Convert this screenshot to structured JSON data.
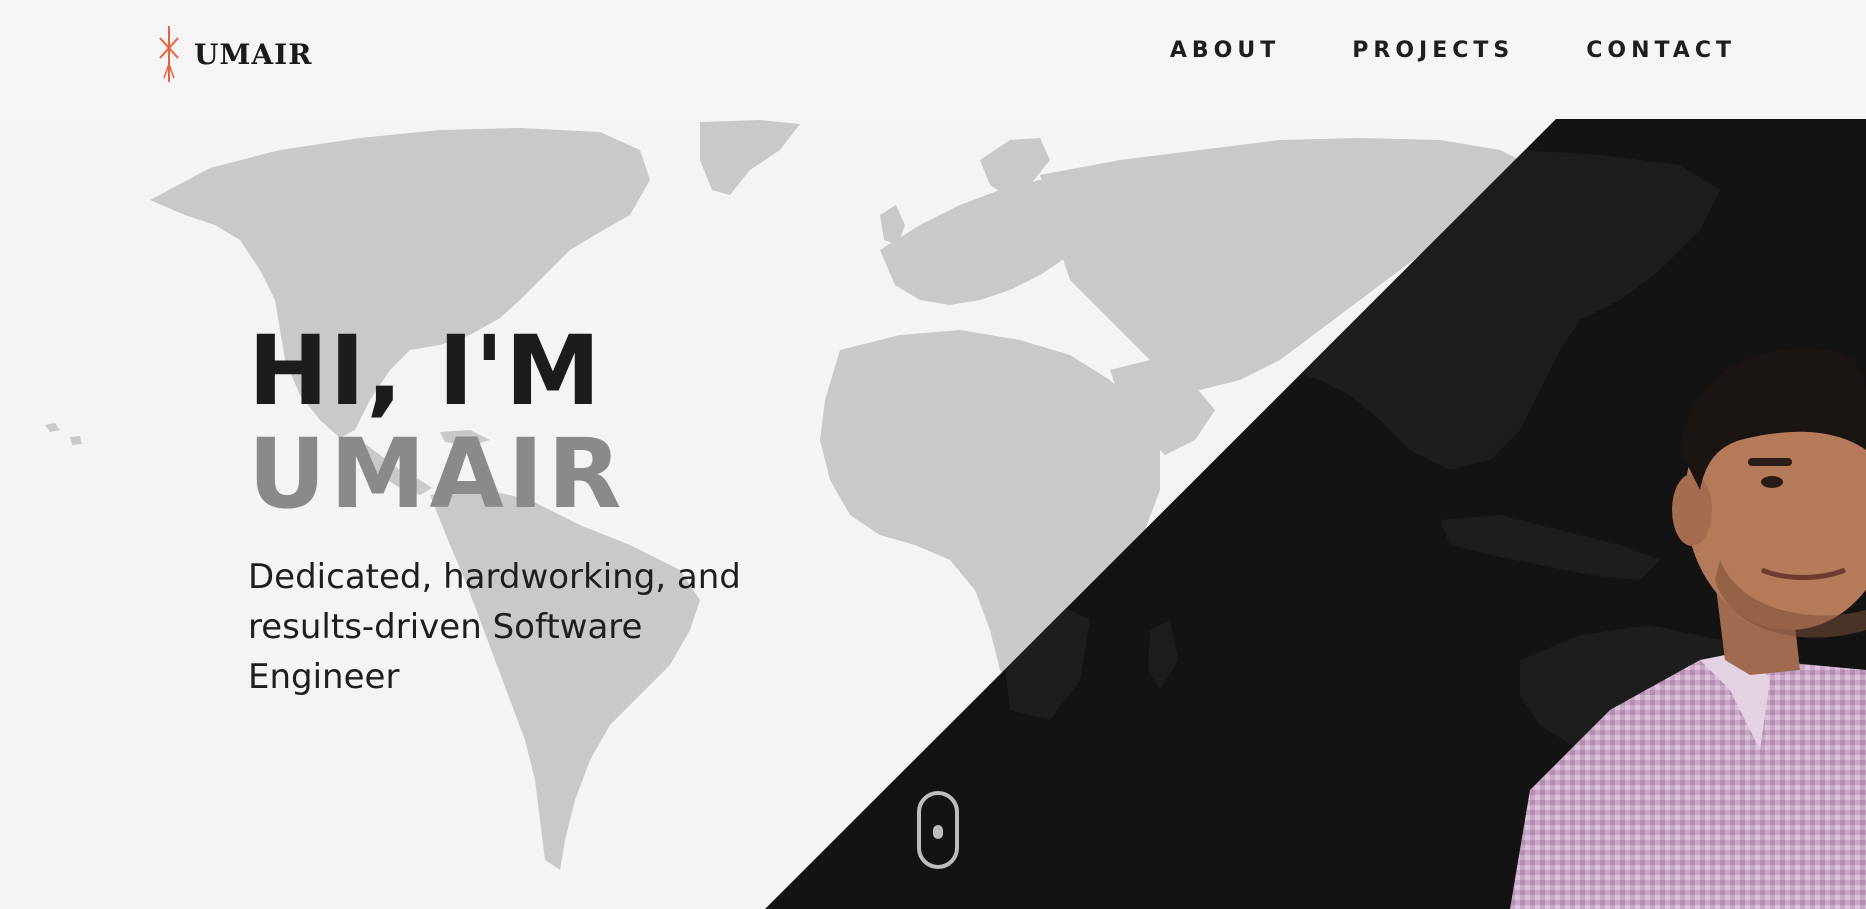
{
  "brand": {
    "name": "UMAIR"
  },
  "nav": {
    "items": [
      {
        "label": "ABOUT"
      },
      {
        "label": "PROJECTS"
      },
      {
        "label": "CONTACT"
      }
    ]
  },
  "hero": {
    "greeting": "HI, I'M",
    "name": "UMAIR",
    "tagline": "Dedicated, hardworking, and results-driven Software Engineer"
  },
  "colors": {
    "background": "#f4f4f6",
    "dark_panel": "#131313",
    "accent_logo": "#e8603c",
    "name_gray": "#8a8a8a",
    "text": "#1c1c1c"
  },
  "icons": {
    "logo": "rune-logo-icon",
    "scroll": "mouse-scroll-icon"
  }
}
